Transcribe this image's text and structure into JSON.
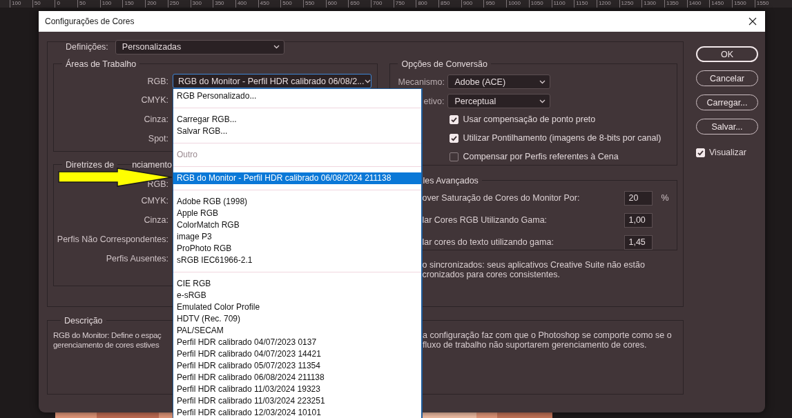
{
  "ruler": {
    "labels": [
      "100",
      "50",
      "0",
      "50",
      "100",
      "150",
      "200",
      "250",
      "300",
      "350",
      "400",
      "450",
      "500",
      "550",
      "600",
      "650",
      "700",
      "750",
      "800",
      "850",
      "900",
      "950",
      "1000",
      "1050",
      "1100",
      "1150",
      "1200",
      "1250",
      "1300",
      "1350",
      "1400",
      "1450",
      "1500",
      "1550"
    ]
  },
  "window": {
    "title": "Configurações de Cores"
  },
  "settings": {
    "label": "Definições:",
    "value": "Personalizadas"
  },
  "working_spaces": {
    "title": "Áreas de Trabalho",
    "rows": [
      {
        "label": "RGB:",
        "value": "RGB do Monitor - Perfil HDR calibrado 06/08/2..."
      },
      {
        "label": "CMYK:"
      },
      {
        "label": "Cinza:"
      },
      {
        "label": "Spot:"
      }
    ]
  },
  "policies": {
    "title_parts": [
      "Diretrizes de",
      "nciamento"
    ],
    "rows": [
      "RGB:",
      "CMYK:",
      "Cinza:",
      "Perfis Não Correspondentes:",
      "Perfis Ausentes:"
    ]
  },
  "conversion": {
    "title": "Opções de Conversão",
    "fields": [
      {
        "label": "Mecanismo:",
        "value": "Adobe (ACE)"
      },
      {
        "label": "etivo:",
        "value": "Perceptual"
      }
    ],
    "checkboxes": [
      {
        "label": "Usar compensação de ponto preto",
        "checked": true
      },
      {
        "label": "Utilizar Pontilhamento (imagens de 8-bits por canal)",
        "checked": true
      },
      {
        "label": "Compensar por Perfis referentes à Cena",
        "checked": false
      }
    ]
  },
  "advanced": {
    "title": "les Avançados",
    "rows": [
      {
        "label": "over Saturação de Cores do Monitor Por:",
        "value": "20",
        "unit": "%"
      },
      {
        "label": "lar Cores RGB Utilizando Gama:",
        "value": "1,00"
      },
      {
        "label": "lar cores do texto utilizando gama:",
        "value": "1,45"
      }
    ]
  },
  "sync_note": [
    "o sincronizados: seus aplicativos Creative Suite não estão",
    "cronizados para cores consistentes."
  ],
  "description": {
    "title": "Descrição",
    "lines": [
      {
        "left": "RGB do Monitor: Define o espaç",
        "right": "a configuração faz com que o Photoshop se comporte como se o"
      },
      {
        "left": "gerenciamento de cores estives",
        "right": "fluxo de trabalho não suportarem gerenciamento de cores."
      }
    ]
  },
  "buttons": [
    {
      "label": "OK",
      "default": true
    },
    {
      "label": "Cancelar",
      "default": false
    },
    {
      "label": "Carregar...",
      "default": false
    },
    {
      "label": "Salvar...",
      "default": false
    }
  ],
  "preview": {
    "label": "Visualizar",
    "checked": true
  },
  "dropdown": {
    "items": [
      {
        "kind": "item",
        "label": "RGB Personalizado...",
        "selected": false
      },
      {
        "kind": "separator"
      },
      {
        "kind": "item",
        "label": "Carregar RGB...",
        "selected": false
      },
      {
        "kind": "item",
        "label": "Salvar RGB...",
        "selected": false
      },
      {
        "kind": "separator"
      },
      {
        "kind": "disabled",
        "label": "Outro",
        "selected": false
      },
      {
        "kind": "separator"
      },
      {
        "kind": "item",
        "label": "RGB do Monitor - Perfil HDR calibrado 06/08/2024 211138",
        "selected": true
      },
      {
        "kind": "separator"
      },
      {
        "kind": "item",
        "label": "Adobe RGB (1998)",
        "selected": false
      },
      {
        "kind": "item",
        "label": "Apple RGB",
        "selected": false
      },
      {
        "kind": "item",
        "label": "ColorMatch RGB",
        "selected": false
      },
      {
        "kind": "item",
        "label": "image P3",
        "selected": false
      },
      {
        "kind": "item",
        "label": "ProPhoto RGB",
        "selected": false
      },
      {
        "kind": "item",
        "label": "sRGB IEC61966-2.1",
        "selected": false
      },
      {
        "kind": "separator"
      },
      {
        "kind": "item",
        "label": "CIE RGB",
        "selected": false
      },
      {
        "kind": "item",
        "label": "e-sRGB",
        "selected": false
      },
      {
        "kind": "item",
        "label": "Emulated Color Profile",
        "selected": false
      },
      {
        "kind": "item",
        "label": "HDTV (Rec. 709)",
        "selected": false
      },
      {
        "kind": "item",
        "label": "PAL/SECAM",
        "selected": false
      },
      {
        "kind": "item",
        "label": "Perfil HDR calibrado 04/07/2023 0137",
        "selected": false
      },
      {
        "kind": "item",
        "label": "Perfil HDR calibrado 04/07/2023 14421",
        "selected": false
      },
      {
        "kind": "item",
        "label": "Perfil HDR calibrado 05/07/2023 11354",
        "selected": false
      },
      {
        "kind": "item",
        "label": "Perfil HDR calibrado 06/08/2024 211138",
        "selected": false
      },
      {
        "kind": "item",
        "label": "Perfil HDR calibrado 11/03/2024 19323",
        "selected": false
      },
      {
        "kind": "item",
        "label": "Perfil HDR calibrado 11/03/2024 223251",
        "selected": false
      },
      {
        "kind": "item",
        "label": "Perfil HDR calibrado 12/03/2024 10101",
        "selected": false
      }
    ]
  }
}
